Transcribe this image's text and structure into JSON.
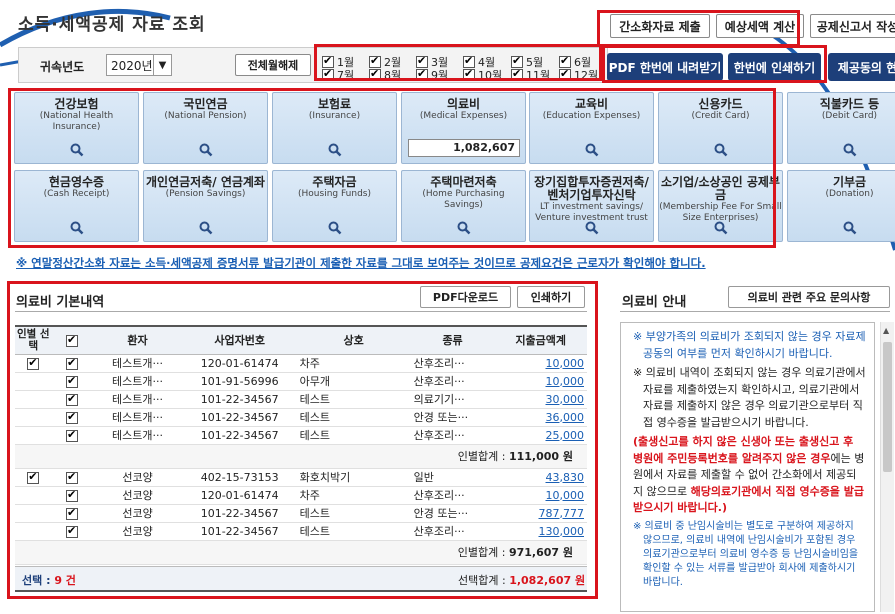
{
  "header": {
    "title": "소득·세액공제 자료 조회",
    "buttons": {
      "simple_submit": "간소화자료 제출",
      "estimate_tax": "예상세액 계산",
      "deduction_form": "공제신고서 작성"
    }
  },
  "year": {
    "label": "귀속년도",
    "value": "2020년",
    "cancel_all": "전체월해제"
  },
  "months": [
    "1월",
    "2월",
    "3월",
    "4월",
    "5월",
    "6월",
    "7월",
    "8월",
    "9월",
    "10월",
    "11월",
    "12월"
  ],
  "actions": {
    "pdf_download_all": "PDF 한번에 내려받기",
    "print_all": "한번에 인쇄하기",
    "provider": "제공동의 현황"
  },
  "tiles": [
    {
      "ko": "건강보험",
      "en": "(National Health Insurance)"
    },
    {
      "ko": "국민연금",
      "en": "(National Pension)"
    },
    {
      "ko": "보험료",
      "en": "(Insurance)"
    },
    {
      "ko": "의료비",
      "en": "(Medical Expenses)",
      "amount": "1,082,607"
    },
    {
      "ko": "교육비",
      "en": "(Education Expenses)"
    },
    {
      "ko": "신용카드",
      "en": "(Credit Card)"
    },
    {
      "ko": "직불카드 등",
      "en": "(Debit Card)"
    },
    {
      "ko": "현금영수증",
      "en": "(Cash Receipt)"
    },
    {
      "ko": "개인연금저축/ 연금계좌",
      "en": "(Pension Savings)"
    },
    {
      "ko": "주택자금",
      "en": "(Housing Funds)"
    },
    {
      "ko": "주택마련저축",
      "en": "(Home Purchasing Savings)"
    },
    {
      "ko": "장기집합투자증권저축/ 벤처기업투자신탁",
      "en": "LT investment savings/ Venture investment trust"
    },
    {
      "ko": "소기업/소상공인 공제부금",
      "en": "(Membership Fee For Small Size Enterprises)"
    },
    {
      "ko": "기부금",
      "en": "(Donation)"
    }
  ],
  "notice": "※ 연말정산간소화 자료는 소득·세액공제 증명서류 발급기관이 제출한 자료를 그대로 보여주는 것이므로 공제요건은 근로자가 확인해야 합니다.",
  "medical": {
    "title": "의료비 기본내역",
    "pdf_btn": "PDF다운로드",
    "print_btn": "인쇄하기",
    "columns": [
      "인별 선택",
      "",
      "환자",
      "사업자번호",
      "상호",
      "종류",
      "지출금액계"
    ],
    "groups": [
      {
        "rows": [
          {
            "patient": "테스트개···",
            "bizno": "120-01-61474",
            "name": "차주",
            "type": "산후조리···",
            "amount": "10,000"
          },
          {
            "patient": "테스트개···",
            "bizno": "101-91-56996",
            "name": "아무개",
            "type": "산후조리···",
            "amount": "10,000"
          },
          {
            "patient": "테스트개···",
            "bizno": "101-22-34567",
            "name": "테스트",
            "type": "의료기기···",
            "amount": "30,000"
          },
          {
            "patient": "테스트개···",
            "bizno": "101-22-34567",
            "name": "테스트",
            "type": "안경 또는···",
            "amount": "36,000"
          },
          {
            "patient": "테스트개···",
            "bizno": "101-22-34567",
            "name": "테스트",
            "type": "산후조리···",
            "amount": "25,000"
          }
        ],
        "subtotal_label": "인별합계 :",
        "subtotal": "111,000 원"
      },
      {
        "rows": [
          {
            "patient": "선코양",
            "bizno": "402-15-73153",
            "name": "화호치박기",
            "type": "일반",
            "amount": "43,830"
          },
          {
            "patient": "선코양",
            "bizno": "120-01-61474",
            "name": "차주",
            "type": "산후조리···",
            "amount": "10,000"
          },
          {
            "patient": "선코양",
            "bizno": "101-22-34567",
            "name": "테스트",
            "type": "안경 또는···",
            "amount": "787,777"
          },
          {
            "patient": "선코양",
            "bizno": "101-22-34567",
            "name": "테스트",
            "type": "산후조리···",
            "amount": "130,000"
          }
        ],
        "subtotal_label": "인별합계 :",
        "subtotal": "971,607 원"
      }
    ],
    "selected_label": "선택 :",
    "selected_count": "9 건",
    "total_label": "선택합계 :",
    "total": "1,082,607 원"
  },
  "info": {
    "title": "의료비 안내",
    "faq_btn": "의료비 관련 주요 문의사항",
    "p1": "※ 부양가족의 의료비가 조회되지 않는 경우 자료제공동의 여부를 먼저 확인하시기 바랍니다.",
    "p2": "※ 의료비 내역이 조회되지 않는 경우 의료기관에서 자료를 제출하였는지 확인하시고, 의료기관에서 자료를 제출하지 않은 경우 의료기관으로부터 직접 영수증을 발급받으시기 바랍니다.",
    "p3a": "(출생신고를 하지 않은 신생아 또는 출생신고 후 병원에 주민등록번호를 알려주지 않은 경우",
    "p3b": "에는 병원에서 자료를 제출할 수 없어 간소화에서 제공되지 않으므로 ",
    "p3c": "해당의료기관에서 직접 영수증을 발급받으시기 바랍니다.)",
    "p4": "※ 의료비 중 난임시술비는 별도로 구분하여 제공하지 않으므로, 의료비 내역에 난임시술비가 포함된 경우 의료기관으로부터 의료비 영수증 등 난임시술비임을 확인할 수 있는 서류를 발급받아 회사에 제출하시기 바랍니다."
  },
  "colors": {
    "red": "#d9141c",
    "navy": "#1d3f7a",
    "link": "#1a5fb4"
  }
}
